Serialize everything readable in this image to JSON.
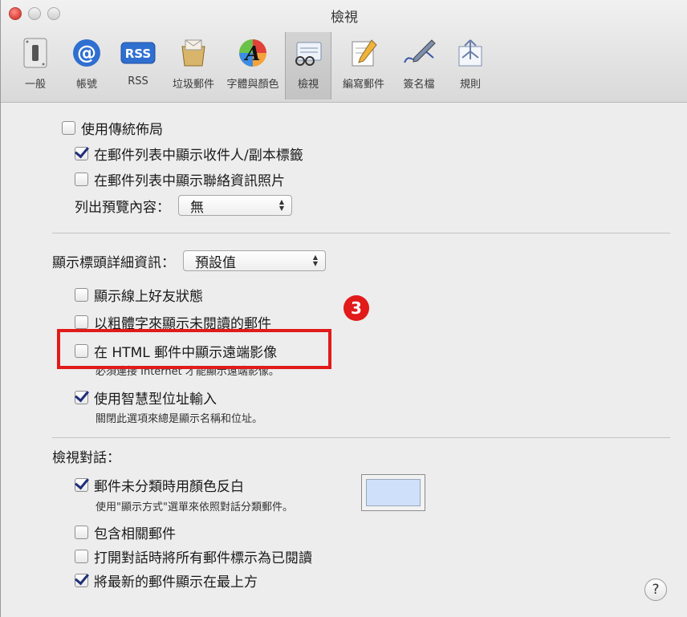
{
  "window": {
    "title": "檢視"
  },
  "toolbar": {
    "items": [
      {
        "label": "一般",
        "icon": "switch-icon"
      },
      {
        "label": "帳號",
        "icon": "at-sign-icon"
      },
      {
        "label": "RSS",
        "icon": "rss-icon"
      },
      {
        "label": "垃圾郵件",
        "icon": "junk-mail-icon"
      },
      {
        "label": "字體與顏色",
        "icon": "fonts-colors-icon"
      },
      {
        "label": "檢視",
        "icon": "viewing-icon",
        "selected": true
      },
      {
        "label": "編寫郵件",
        "icon": "compose-icon"
      },
      {
        "label": "簽名檔",
        "icon": "signature-icon"
      },
      {
        "label": "規則",
        "icon": "rules-icon"
      }
    ]
  },
  "layout_section": {
    "classic_layout": {
      "label": "使用傳統佈局",
      "checked": false
    },
    "show_to_cc": {
      "label": "在郵件列表中顯示收件人/副本標籤",
      "checked": true
    },
    "show_contact_photos": {
      "label": "在郵件列表中顯示聯絡資訊照片",
      "checked": false
    },
    "preview_label": "列出預覽內容：",
    "preview_value": "無"
  },
  "header_section": {
    "header_detail_label": "顯示標頭詳細資訊：",
    "header_detail_value": "預設值",
    "online_buddy": {
      "label": "顯示線上好友狀態",
      "checked": false
    },
    "bold_unread": {
      "label": "以粗體字來顯示未閱讀的郵件",
      "checked": false
    },
    "remote_images": {
      "label": "在 HTML 郵件中顯示遠端影像",
      "checked": false,
      "sub": "必須連接 Internet 才能顯示遠端影像。"
    },
    "smart_addresses": {
      "label": "使用智慧型位址輸入",
      "checked": true,
      "sub": "關閉此選項來總是顯示名稱和位址。"
    }
  },
  "conversation_section": {
    "title": "檢視對話：",
    "highlight_color": {
      "label": "郵件未分類時用顏色反白",
      "checked": true,
      "sub": "使用\"顯示方式\"選單來依照對話分類郵件。",
      "color": "#cfe0fa"
    },
    "include_related": {
      "label": "包含相關郵件",
      "checked": false
    },
    "mark_read": {
      "label": "打開對話時將所有郵件標示為已閱讀",
      "checked": false
    },
    "newest_on_top": {
      "label": "將最新的郵件顯示在最上方",
      "checked": true
    }
  },
  "annotation": {
    "badge": "3",
    "color": "#e11a1a"
  },
  "help": {
    "label": "?"
  }
}
